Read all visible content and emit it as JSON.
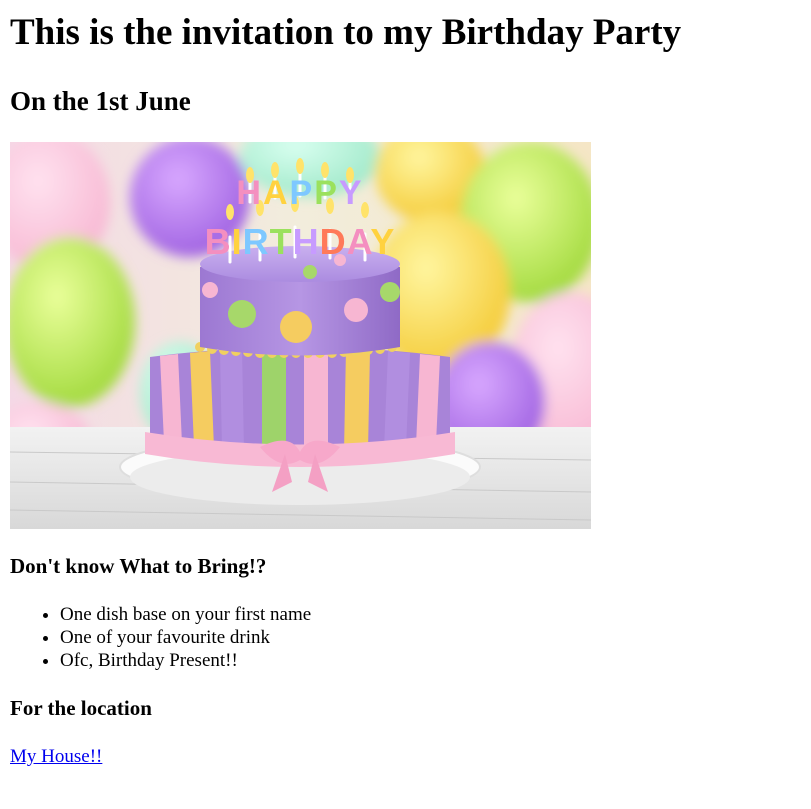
{
  "title": "This is the invitation to my Birthday Party",
  "subtitle": "On the 1st June",
  "hero_image": {
    "cake_text_line1": "HAPPY",
    "cake_text_line2": "BIRTHDAY"
  },
  "bring_section": {
    "heading": "Don't know What to Bring!?",
    "items": [
      "One dish base on your first name",
      "One of your favourite drink",
      "Ofc, Birthday Present!!"
    ]
  },
  "location_section": {
    "heading": "For the location",
    "link_text": "My House!!"
  },
  "colors": {
    "link": "#0000ee",
    "text": "#000000",
    "background": "#ffffff"
  }
}
